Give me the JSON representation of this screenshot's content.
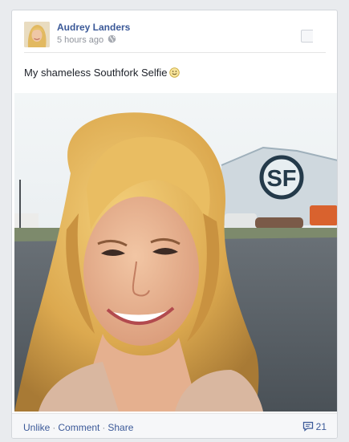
{
  "post": {
    "author": "Audrey Landers",
    "timestamp": "5 hours ago",
    "audience_icon": "globe-icon",
    "message": "My shameless Southfork Selfie",
    "emoticon": "smiley-icon",
    "photo": {
      "sign_text": "SF"
    }
  },
  "footer": {
    "unlike_label": "Unlike",
    "comment_label": "Comment",
    "share_label": "Share",
    "separator": "·",
    "comment_icon": "comment-bubble-icon",
    "comment_count": "21"
  },
  "colors": {
    "link": "#3b5998",
    "text": "#1d2129",
    "meta": "#90949c"
  }
}
